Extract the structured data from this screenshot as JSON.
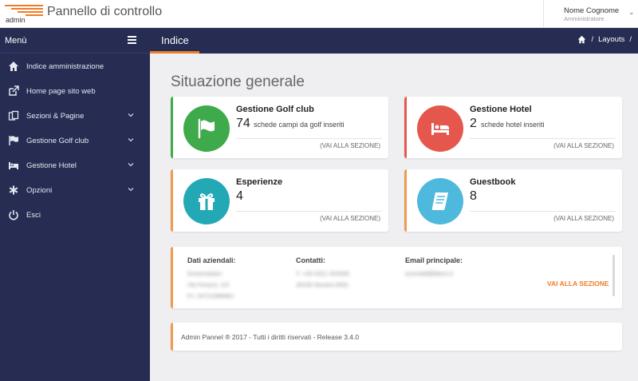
{
  "header": {
    "logo_text": "admin",
    "app_title": "Pannello di controllo",
    "user_name": "Nome Cognome",
    "user_role": "Amministratore",
    "user_caret": "⌄"
  },
  "sidebar": {
    "menu_label": "Menù",
    "items": [
      {
        "label": "Indice amministrazione",
        "icon": "home-icon"
      },
      {
        "label": "Home page sito web",
        "icon": "external-link-icon"
      },
      {
        "label": "Sezioni & Pagine",
        "icon": "pages-icon"
      },
      {
        "label": "Gestione Golf club",
        "icon": "flag-icon"
      },
      {
        "label": "Gestione Hotel",
        "icon": "bed-icon"
      },
      {
        "label": "Opzioni",
        "icon": "asterisk-icon"
      },
      {
        "label": "Esci",
        "icon": "power-icon"
      }
    ]
  },
  "page": {
    "title": "Indice",
    "breadcrumb": [
      "Layouts"
    ],
    "breadcrumb_sep": "/",
    "section_title": "Situazione generale"
  },
  "cards": [
    {
      "title": "Gestione Golf club",
      "count": "74",
      "desc": "schede campi da golf inseriti",
      "link": "(VAI ALLA SEZIONE)",
      "color": "#3faa4b",
      "accent": "#3faa4b",
      "icon": "flag-icon"
    },
    {
      "title": "Gestione Hotel",
      "count": "2",
      "desc": "schede hotel inseriti",
      "link": "(VAI ALLA SEZIONE)",
      "color": "#e5574d",
      "accent": "#e5574d",
      "icon": "bed-icon"
    },
    {
      "title": "Esperienze",
      "count": "4",
      "desc": "",
      "link": "(VAI ALLA SEZIONE)",
      "color": "#23a9b5",
      "accent": "#ef9a4c",
      "icon": "gift-icon"
    },
    {
      "title": "Guestbook",
      "count": "8",
      "desc": "",
      "link": "(VAI ALLA SEZIONE)",
      "color": "#4fb8dd",
      "accent": "#ef9a4c",
      "icon": "book-icon"
    }
  ],
  "info": {
    "company_label": "Dati aziendali:",
    "company_lines": [
      "Dreamsteam",
      "Via Ferazzi, 1/C",
      "P.I. 04721986961"
    ],
    "contacts_label": "Contatti:",
    "contacts_lines": [
      "T. +39 0321 204309",
      "28100 Novara (NO)"
    ],
    "email_label": "Email principale:",
    "email_lines": [
      "scomatti@libero.it"
    ],
    "link": "VAI ALLA SEZIONE"
  },
  "footer": {
    "text": "Admin Pannel ® 2017 - Tutti i diritti riservati - Release 3.4.0"
  },
  "colors": {
    "sidebar_bg": "#262c52",
    "accent_orange": "#ef7c2a",
    "page_bg": "#efeff2"
  }
}
